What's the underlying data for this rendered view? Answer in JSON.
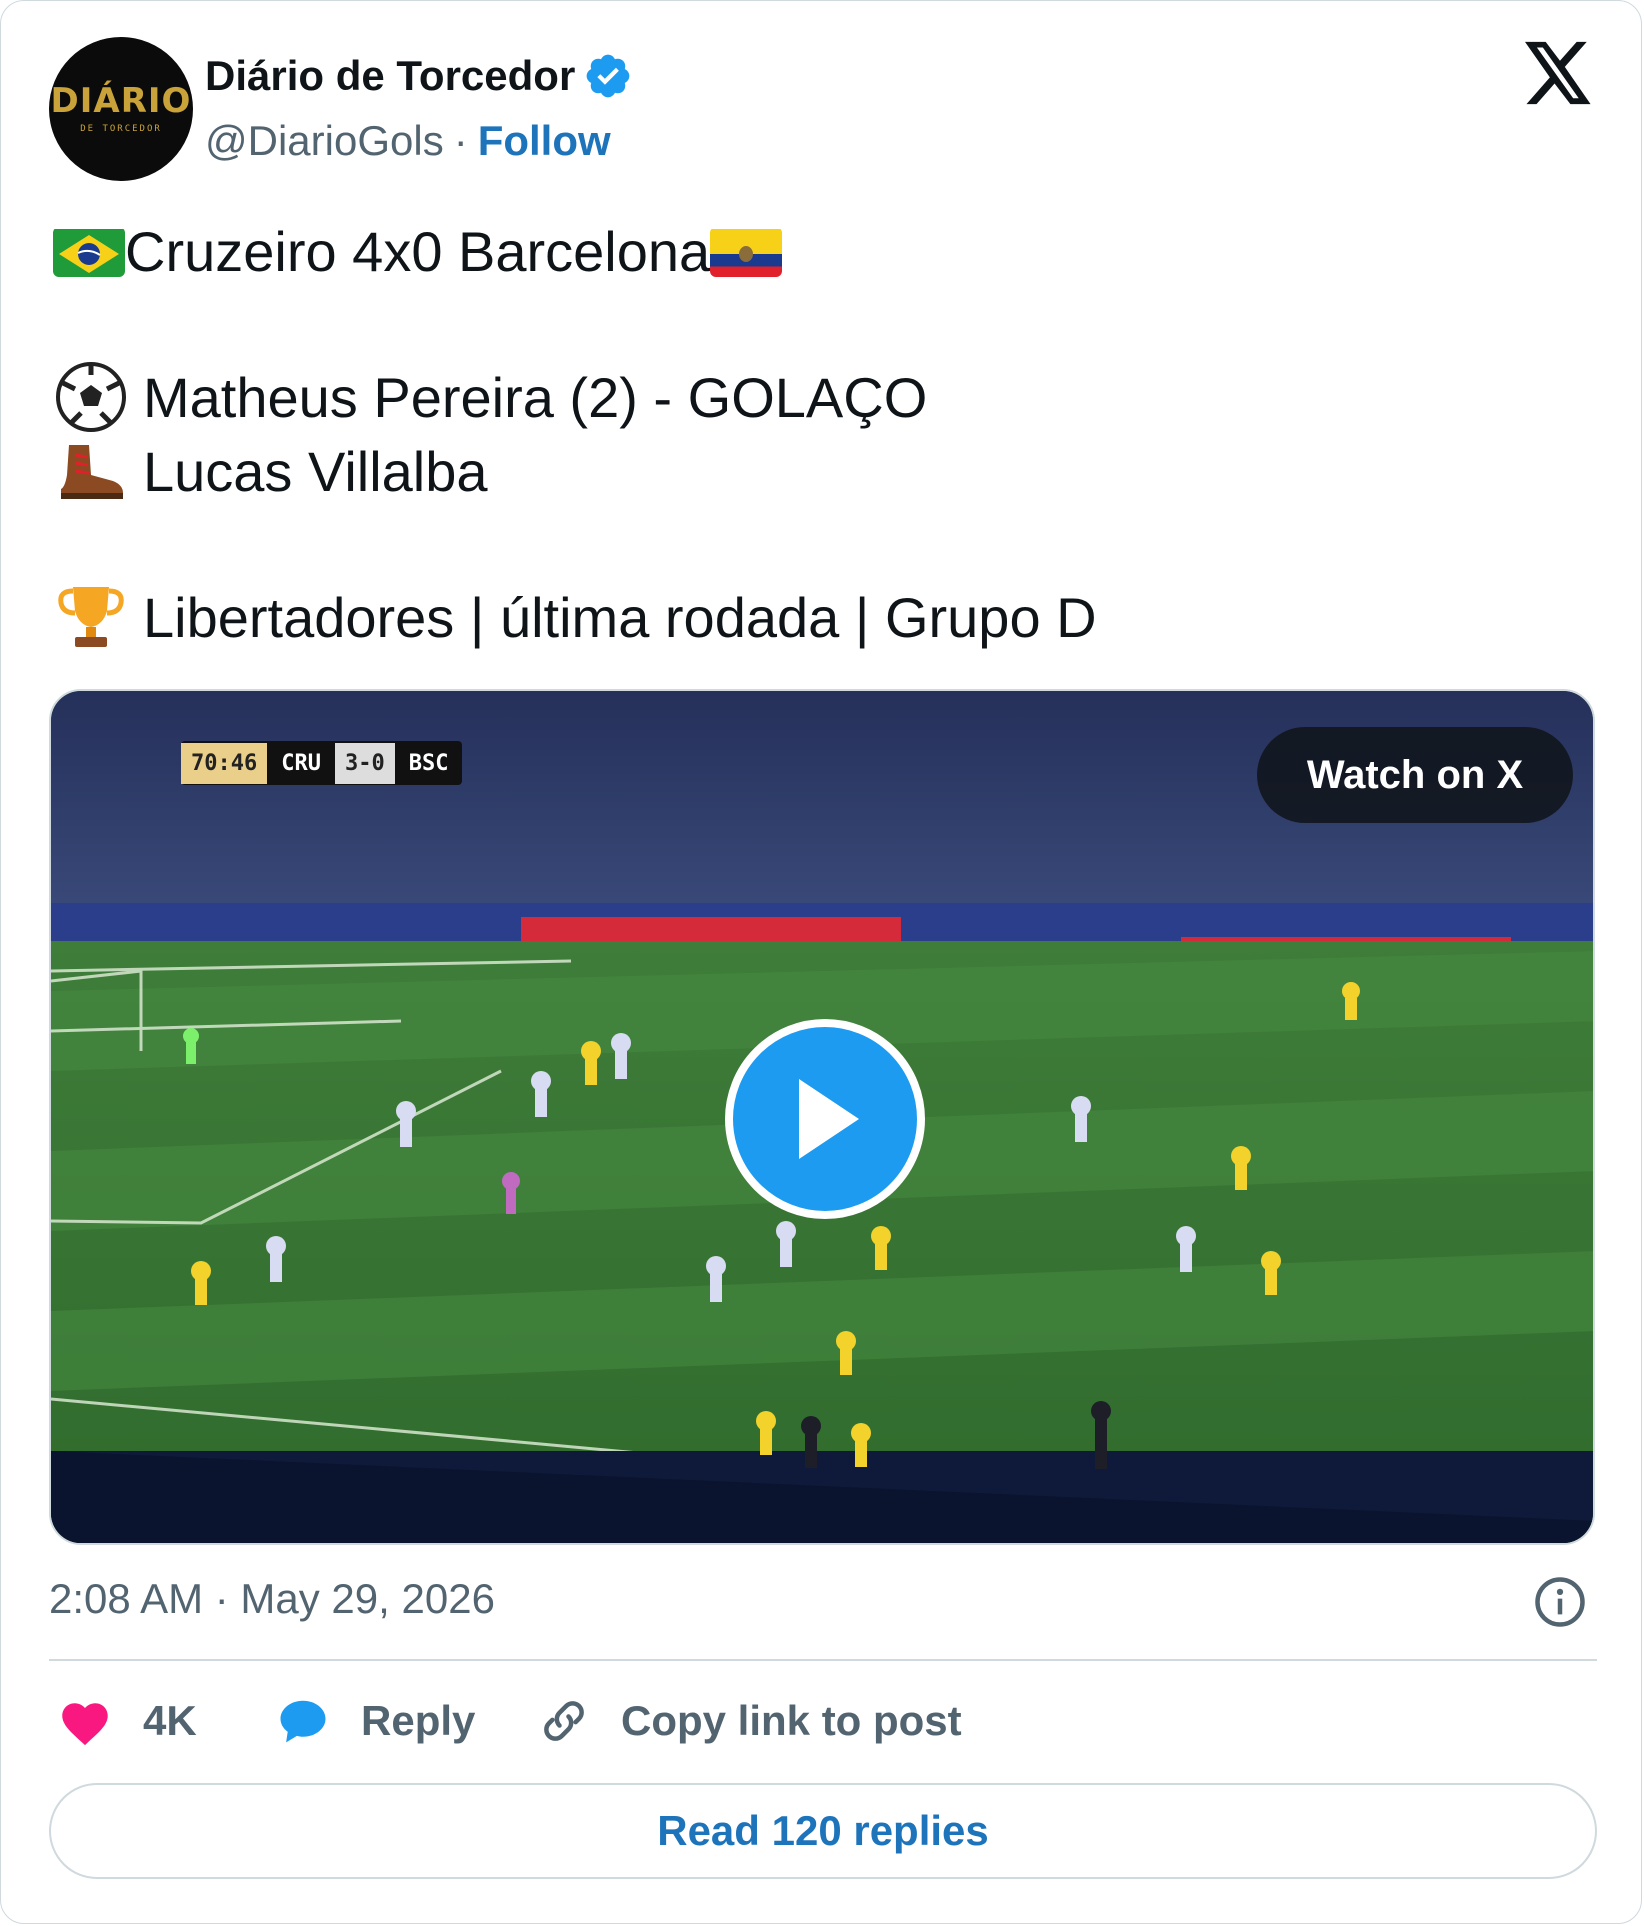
{
  "author": {
    "avatar_text": "DIÁRIO",
    "avatar_subtext": "DE TORCEDOR",
    "name": "Diário de Torcedor",
    "handle": "@DiarioGols",
    "separator": "·",
    "follow_label": "Follow"
  },
  "post": {
    "line1_text": "Cruzeiro 4x0 Barcelona",
    "line2_text": "Matheus Pereira (2) - GOLAÇO",
    "line3_text": "Lucas Villalba",
    "line4_text": "Libertadores | última rodada | Grupo D"
  },
  "media": {
    "scoreboard_time": "70:46",
    "scoreboard_home": "CRU",
    "scoreboard_score": "3-0",
    "scoreboard_away": "BSC",
    "watch_label": "Watch on X"
  },
  "meta": {
    "timestamp": "2:08 AM · May 29, 2026"
  },
  "actions": {
    "likes": "4K",
    "reply_label": "Reply",
    "copy_label": "Copy link to post",
    "read_replies_label": "Read 120 replies"
  },
  "colors": {
    "link": "#1d74bb",
    "verified": "#1d9bf0",
    "like": "#f91880",
    "muted": "#536471"
  }
}
